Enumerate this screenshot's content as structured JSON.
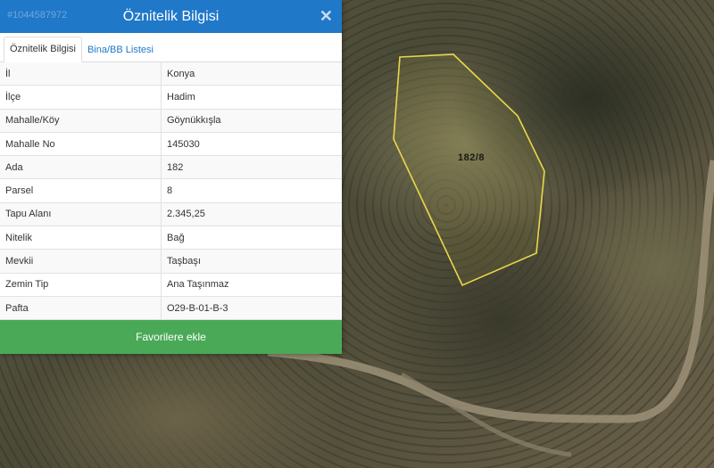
{
  "panel": {
    "title": "Öznitelik Bilgisi",
    "listing_no": "#1044587972",
    "close_glyph": "✕",
    "tabs": [
      {
        "label": "Öznitelik Bilgisi",
        "active": true
      },
      {
        "label": "Bina/BB Listesi",
        "active": false
      }
    ],
    "rows": [
      {
        "key": "İl",
        "value": "Konya"
      },
      {
        "key": "İlçe",
        "value": "Hadim"
      },
      {
        "key": "Mahalle/Köy",
        "value": "Göynükkışla"
      },
      {
        "key": "Mahalle No",
        "value": "145030"
      },
      {
        "key": "Ada",
        "value": "182"
      },
      {
        "key": "Parsel",
        "value": "8"
      },
      {
        "key": "Tapu Alanı",
        "value": "2.345,25"
      },
      {
        "key": "Nitelik",
        "value": "Bağ"
      },
      {
        "key": "Mevkii",
        "value": "Taşbaşı"
      },
      {
        "key": "Zemin Tip",
        "value": "Ana Taşınmaz"
      },
      {
        "key": "Pafta",
        "value": "O29-B-01-B-3"
      }
    ],
    "favorite_button": "Favorilere ekle"
  },
  "map": {
    "parcel_label": "182/8",
    "parcel_outline_color": "#e8d84a",
    "compass_icon": "compass-rose-icon"
  },
  "colors": {
    "header": "#1f78c8",
    "favorite_button": "#4aa957",
    "tab_link": "#1f78c8"
  }
}
